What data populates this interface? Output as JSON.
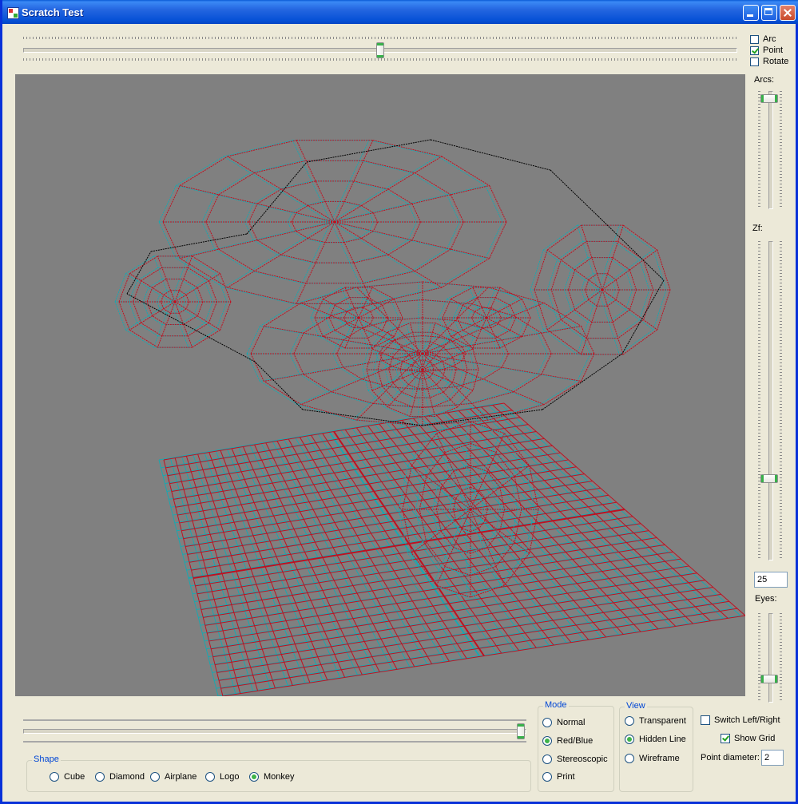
{
  "window": {
    "title": "Scratch Test"
  },
  "top_options": [
    {
      "label": "Arc",
      "checked": false
    },
    {
      "label": "Point",
      "checked": true
    },
    {
      "label": "Rotate",
      "checked": false
    }
  ],
  "right_panel": {
    "arcs_label": "Arcs:",
    "zf_label": "Zf:",
    "zf_value": "25",
    "eyes_label": "Eyes:"
  },
  "shape": {
    "title": "Shape",
    "options": [
      "Cube",
      "Diamond",
      "Airplane",
      "Logo",
      "Monkey"
    ],
    "selected": "Monkey"
  },
  "mode": {
    "title": "Mode",
    "options": [
      "Normal",
      "Red/Blue",
      "Stereoscopic",
      "Print"
    ],
    "selected": "Red/Blue"
  },
  "view": {
    "title": "View",
    "options": [
      "Transparent",
      "Hidden Line",
      "Wireframe"
    ],
    "selected": "Hidden Line"
  },
  "settings": {
    "switch_label": "Switch Left/Right",
    "switch_checked": false,
    "grid_label": "Show Grid",
    "grid_checked": true,
    "point_diameter_label": "Point diameter:",
    "point_diameter_value": "2"
  },
  "colors": {
    "viewport_bg": "#808080",
    "anaglyph_red": "#c01020",
    "anaglyph_cyan": "#18a8b0",
    "wire_black": "#000000"
  }
}
